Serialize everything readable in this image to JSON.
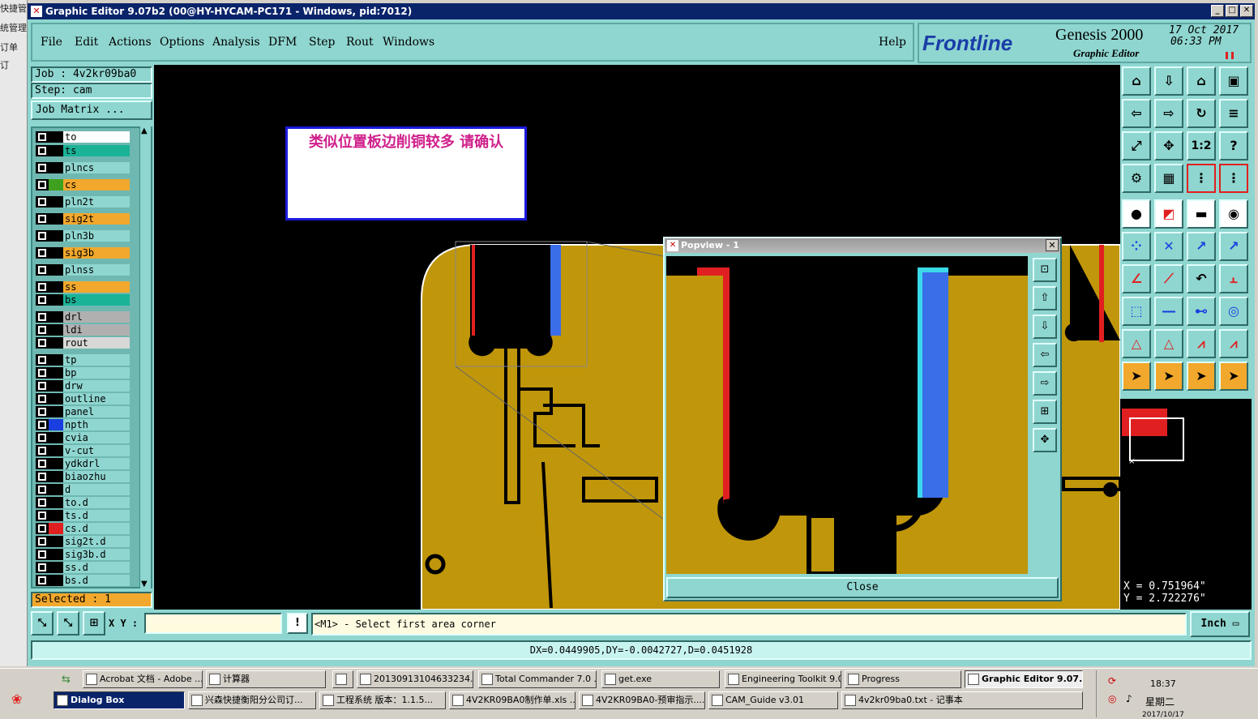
{
  "window": {
    "title": "Graphic Editor 9.07b2 (00@HY-HYCAM-PC171 - Windows, pid:7012)"
  },
  "bg_strip": {
    "texts": [
      "快捷管",
      "统管理",
      "订单",
      "订"
    ]
  },
  "menu": {
    "items": [
      "File",
      "Edit",
      "Actions",
      "Options",
      "Analysis",
      "DFM",
      "Step",
      "Rout",
      "Windows"
    ],
    "help": "Help"
  },
  "brand": {
    "logo": "Frontline",
    "product": "Genesis 2000",
    "subtitle": "Graphic Editor",
    "date": "17 Oct 2017",
    "time": "06:33 PM"
  },
  "job": {
    "job_label": "Job : 4v2kr09ba0",
    "step_label": "Step: cam",
    "matrix_button": "Job Matrix ..."
  },
  "layers": [
    {
      "name": "to",
      "color": "#ffffff",
      "swatch": "#000000"
    },
    {
      "name": "ts",
      "color": "#1bb398",
      "swatch": "#000000"
    },
    {
      "name": "plncs",
      "color": "#8fd6d0",
      "swatch": "#000000"
    },
    {
      "name": "cs",
      "color": "#f2a82c",
      "swatch": "#3fa020"
    },
    {
      "name": "pln2t",
      "color": "#8fd6d0",
      "swatch": "#000000"
    },
    {
      "name": "sig2t",
      "color": "#f2a82c",
      "swatch": "#000000"
    },
    {
      "name": "pln3b",
      "color": "#8fd6d0",
      "swatch": "#000000"
    },
    {
      "name": "sig3b",
      "color": "#f2a82c",
      "swatch": "#000000"
    },
    {
      "name": "plnss",
      "color": "#8fd6d0",
      "swatch": "#000000"
    },
    {
      "name": "ss",
      "color": "#f2a82c",
      "swatch": "#000000"
    },
    {
      "name": "bs",
      "color": "#1bb398",
      "swatch": "#000000"
    },
    {
      "name": "drl",
      "color": "#b0b0b0",
      "swatch": "#000000"
    },
    {
      "name": "ldi",
      "color": "#b0b0b0",
      "swatch": "#000000"
    },
    {
      "name": "rout",
      "color": "#d8d8d8",
      "swatch": "#000000"
    },
    {
      "name": "tp",
      "color": "#8fd6d0",
      "swatch": "#000000"
    },
    {
      "name": "bp",
      "color": "#8fd6d0",
      "swatch": "#000000"
    },
    {
      "name": "drw",
      "color": "#8fd6d0",
      "swatch": "#000000"
    },
    {
      "name": "outline",
      "color": "#8fd6d0",
      "swatch": "#000000"
    },
    {
      "name": "panel",
      "color": "#8fd6d0",
      "swatch": "#000000"
    },
    {
      "name": "npth",
      "color": "#8fd6d0",
      "swatch": "#1a3ee0"
    },
    {
      "name": "cvia",
      "color": "#8fd6d0",
      "swatch": "#000000"
    },
    {
      "name": "v-cut",
      "color": "#8fd6d0",
      "swatch": "#000000"
    },
    {
      "name": "ydkdrl",
      "color": "#8fd6d0",
      "swatch": "#000000"
    },
    {
      "name": "biaozhu",
      "color": "#8fd6d0",
      "swatch": "#000000"
    },
    {
      "name": "d",
      "color": "#8fd6d0",
      "swatch": "#000000"
    },
    {
      "name": "to.d",
      "color": "#8fd6d0",
      "swatch": "#000000"
    },
    {
      "name": "ts.d",
      "color": "#8fd6d0",
      "swatch": "#000000"
    },
    {
      "name": "cs.d",
      "color": "#8fd6d0",
      "swatch": "#e02020"
    },
    {
      "name": "sig2t.d",
      "color": "#8fd6d0",
      "swatch": "#000000"
    },
    {
      "name": "sig3b.d",
      "color": "#8fd6d0",
      "swatch": "#000000"
    },
    {
      "name": "ss.d",
      "color": "#8fd6d0",
      "swatch": "#000000"
    },
    {
      "name": "bs.d",
      "color": "#8fd6d0",
      "swatch": "#000000"
    }
  ],
  "selected_label": "Selected : 1",
  "note": {
    "text": "类似位置板边削铜较多   请确认"
  },
  "popview": {
    "title": "Popview - 1",
    "close_label": "Close"
  },
  "coords": {
    "x": "X = 0.751964\"",
    "y": "Y = 2.722276\""
  },
  "statusbar": {
    "xy_label": "X Y :",
    "xy_value": "",
    "prompt": "<M1> - Select first area corner",
    "units": "Inch",
    "delta": "DX=0.0449905,DY=-0.0042727,D=0.0451928"
  },
  "taskbar": {
    "row1": [
      "Acrobat 文档 - Adobe ...",
      "计算器",
      "",
      "20130913104633234....",
      "Total Commander 7.0 ...",
      "get.exe",
      "Engineering Toolkit 9.0...",
      "Progress",
      "Graphic Editor 9.07..."
    ],
    "row2": [
      "Dialog Box",
      "兴森快捷衡阳分公司订...",
      "工程系统  版本：1.1.5...",
      "4V2KR09BA0制作单.xls ...",
      "4V2KR09BA0-预审指示....",
      "CAM_Guide v3.01",
      "4v2kr09ba0.txt - 记事本"
    ],
    "clock": "18:37",
    "day": "星期二",
    "date": "2017/10/17"
  },
  "colors": {
    "teal": "#8fd6d0",
    "copper": "#c0960a",
    "accent_red": "#e02020",
    "accent_blue": "#3a6ee8"
  }
}
